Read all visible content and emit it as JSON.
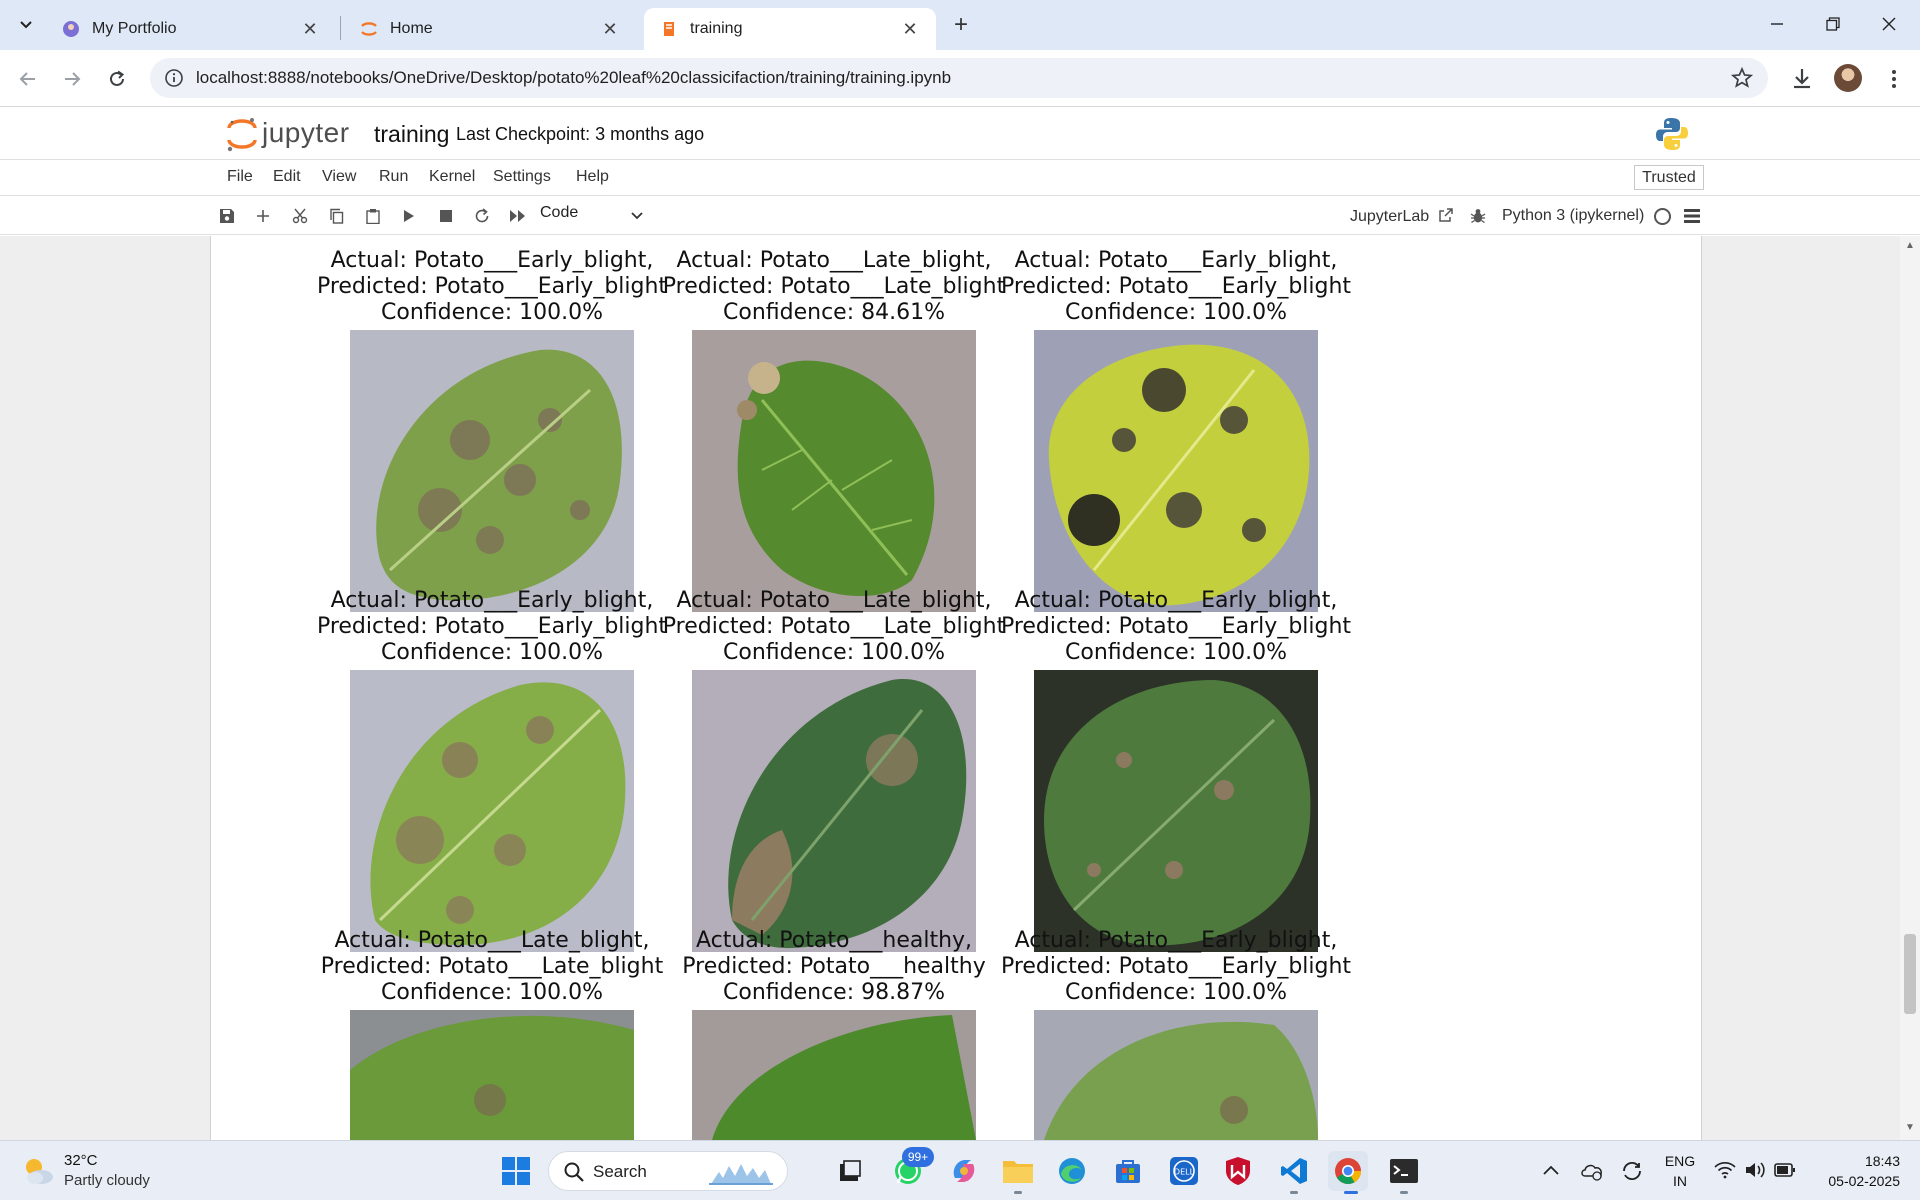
{
  "browser": {
    "tabs": [
      {
        "title": "My Portfolio",
        "icon": "portfolio-favicon"
      },
      {
        "title": "Home",
        "icon": "jupyter-favicon"
      },
      {
        "title": "training",
        "icon": "notebook-favicon",
        "active": true
      }
    ],
    "url": "localhost:8888/notebooks/OneDrive/Desktop/potato%20leaf%20classicifaction/training/training.ipynb"
  },
  "jupyter": {
    "wordmark": "jupyter",
    "notebook_name": "training",
    "checkpoint": "Last Checkpoint: 3 months ago",
    "menu": [
      "File",
      "Edit",
      "View",
      "Run",
      "Kernel",
      "Settings",
      "Help"
    ],
    "trusted": "Trusted",
    "cell_type": "Code",
    "jupyterlab_link": "JupyterLab",
    "kernel": "Python 3 (ipykernel)"
  },
  "output": {
    "rows": [
      [
        {
          "actual": "Actual: Potato___Early_blight,",
          "predicted": "Predicted: Potato___Early_blight",
          "confidence": "Confidence: 100.0%"
        },
        {
          "actual": "Actual: Potato___Late_blight,",
          "predicted": "Predicted: Potato___Late_blight",
          "confidence": "Confidence: 84.61%"
        },
        {
          "actual": "Actual: Potato___Early_blight,",
          "predicted": "Predicted: Potato___Early_blight",
          "confidence": "Confidence: 100.0%"
        }
      ],
      [
        {
          "actual": "Actual: Potato___Early_blight,",
          "predicted": "Predicted: Potato___Early_blight",
          "confidence": "Confidence: 100.0%"
        },
        {
          "actual": "Actual: Potato___Late_blight,",
          "predicted": "Predicted: Potato___Late_blight",
          "confidence": "Confidence: 100.0%"
        },
        {
          "actual": "Actual: Potato___Early_blight,",
          "predicted": "Predicted: Potato___Early_blight",
          "confidence": "Confidence: 100.0%"
        }
      ],
      [
        {
          "actual": "Actual: Potato___Late_blight,",
          "predicted": "Predicted: Potato___Late_blight",
          "confidence": "Confidence: 100.0%"
        },
        {
          "actual": "Actual: Potato___healthy,",
          "predicted": "Predicted: Potato___healthy",
          "confidence": "Confidence: 98.87%"
        },
        {
          "actual": "Actual: Potato___Early_blight,",
          "predicted": "Predicted: Potato___Early_blight",
          "confidence": "Confidence: 100.0%"
        }
      ]
    ]
  },
  "taskbar": {
    "weather_temp": "32°C",
    "weather_desc": "Partly cloudy",
    "search_label": "Search",
    "whatsapp_badge": "99+",
    "lang_top": "ENG",
    "lang_bottom": "IN",
    "time": "18:43",
    "date": "05-02-2025"
  },
  "colors": {
    "tabstrip": "#dfe8f7",
    "jupyter_orange": "#f37726",
    "taskbar": "#e9eef6"
  }
}
